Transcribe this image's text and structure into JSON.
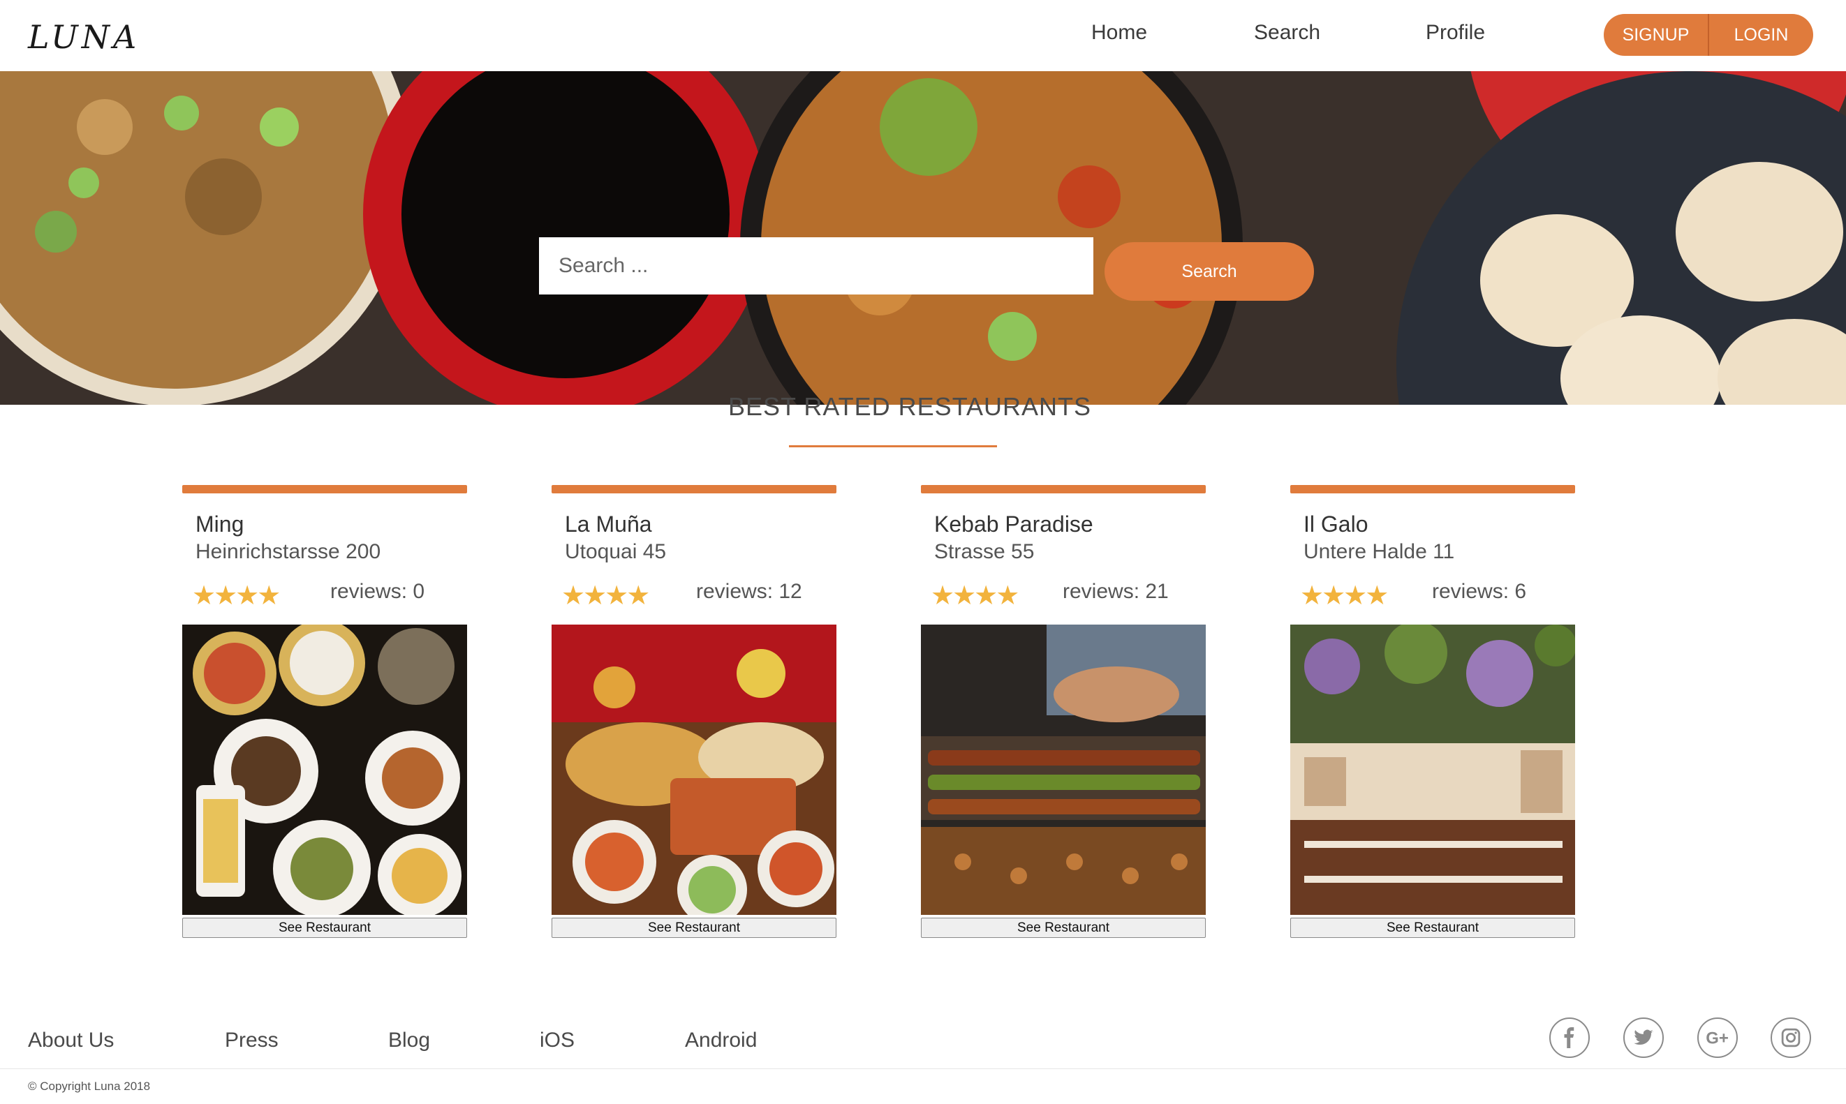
{
  "header": {
    "logo": "LUNA",
    "nav": [
      "Home",
      "Search",
      "Profile"
    ],
    "signup_label": "SIGNUP",
    "login_label": "LOGIN"
  },
  "hero": {
    "search_placeholder": "Search ...",
    "search_button": "Search"
  },
  "section": {
    "title": "BEST RATED RESTAURANTS"
  },
  "restaurants": [
    {
      "name": "Ming",
      "address": "Heinrichstarsse 200",
      "stars": 4,
      "reviews": "reviews: 0",
      "button": "See Restaurant"
    },
    {
      "name": "La Muña",
      "address": "Utoquai 45",
      "stars": 4,
      "reviews": "reviews: 12",
      "button": "See Restaurant"
    },
    {
      "name": "Kebab Paradise",
      "address": "Strasse 55",
      "stars": 4,
      "reviews": "reviews: 21",
      "button": "See Restaurant"
    },
    {
      "name": "Il Galo",
      "address": "Untere Halde 11",
      "stars": 4,
      "reviews": "reviews: 6",
      "button": "See Restaurant"
    }
  ],
  "footer": {
    "links": [
      "About Us",
      "Press",
      "Blog",
      "iOS",
      "Android"
    ],
    "social_icons": [
      "facebook-icon",
      "twitter-icon",
      "google-plus-icon",
      "instagram-icon"
    ],
    "copyright": "© Copyright Luna 2018"
  },
  "colors": {
    "accent": "#e07b3c",
    "star": "#f2b33d",
    "text": "#4a4a4a"
  }
}
